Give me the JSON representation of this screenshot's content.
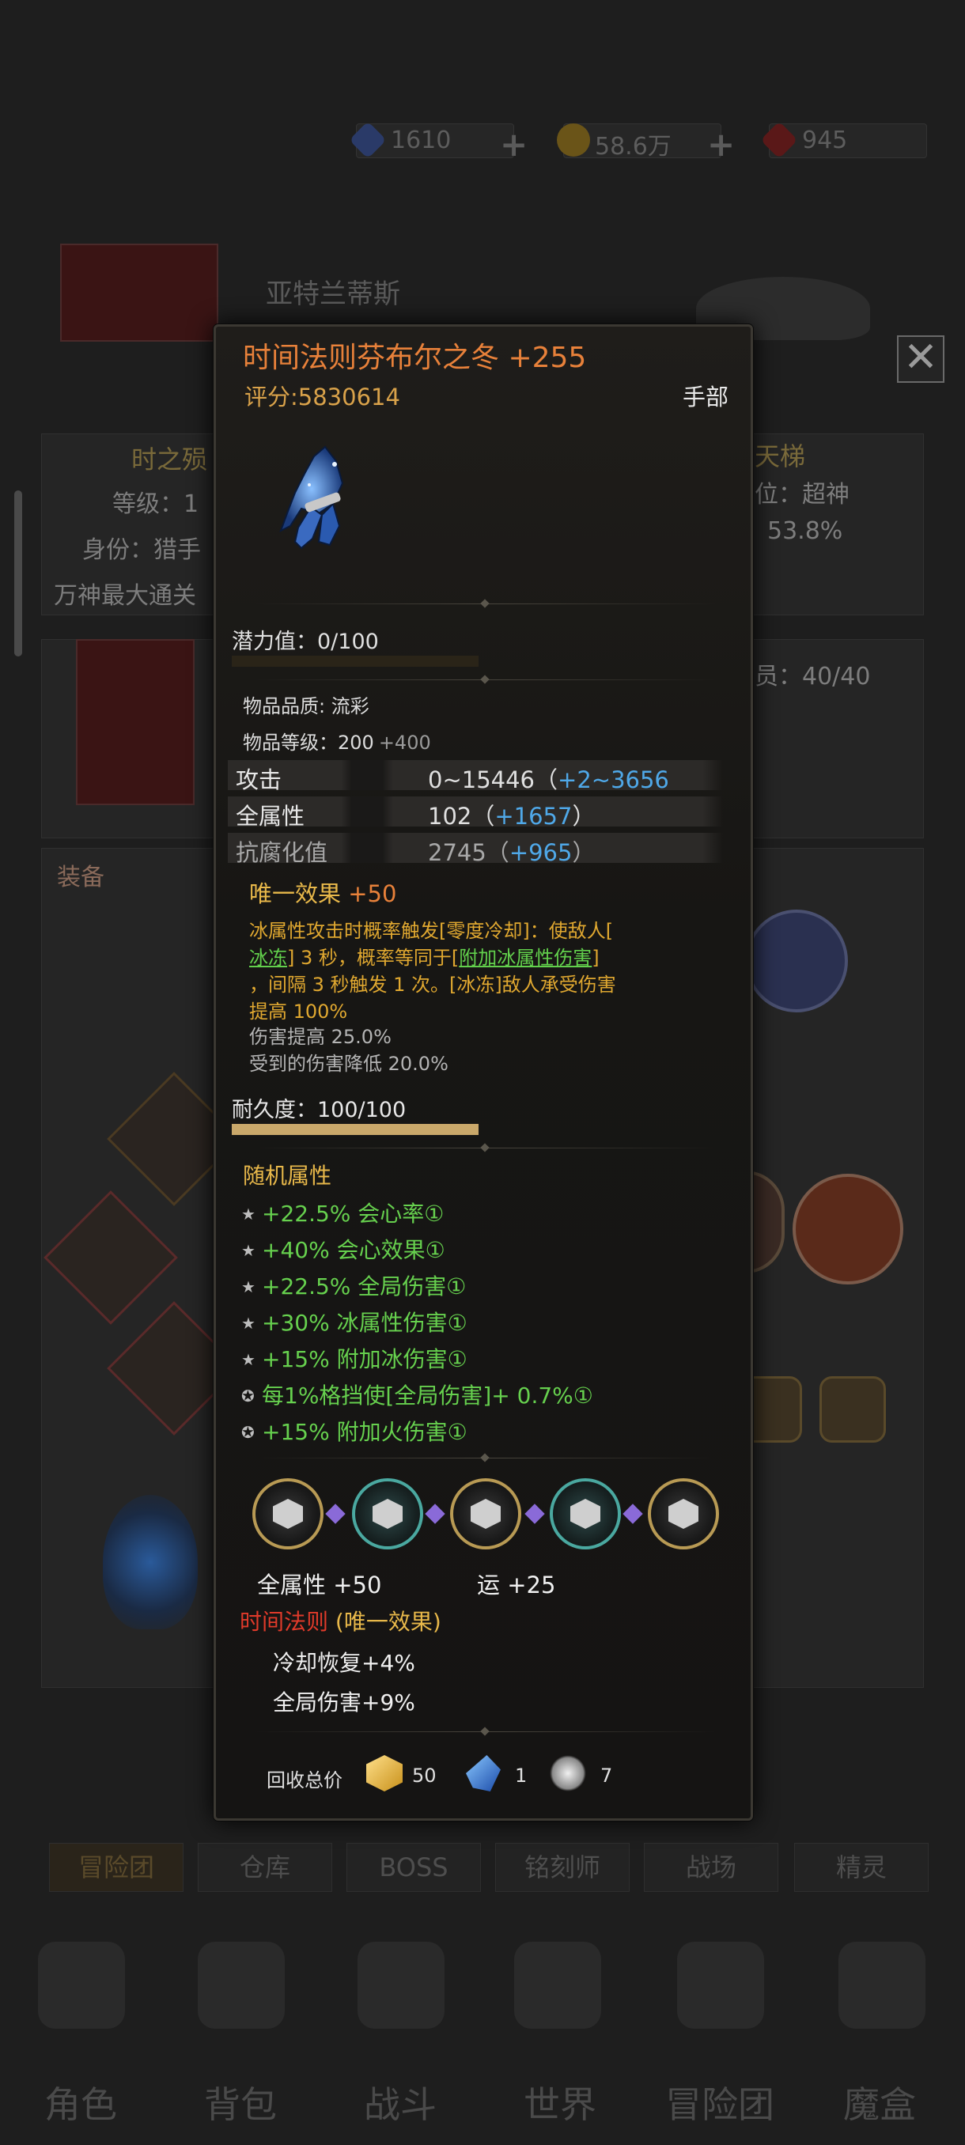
{
  "background": {
    "resources": [
      {
        "icon": "blue-crystal-icon",
        "value": "1610",
        "color": "#3a5aa8"
      },
      {
        "icon": "gold-coin-icon",
        "value": "58.6万",
        "color": "#c8a020"
      },
      {
        "icon": "red-gem-icon",
        "value": "945",
        "color": "#a02828"
      }
    ],
    "player_name": "亚特兰蒂斯",
    "info_left": {
      "title": "时之殒",
      "level": "等级：1",
      "identity": "身份：猎手",
      "pass": "万神最大通关"
    },
    "info_right": {
      "title": "天梯",
      "rank": "位：超神",
      "rate": "：53.8%"
    },
    "guild_members": "成员：40/40",
    "equip_label": "装备",
    "tabs": [
      "冒险团",
      "仓库",
      "BOSS",
      "铭刻师",
      "战场",
      "精灵"
    ],
    "nav": [
      {
        "label": "角色",
        "icon": "helmet-icon"
      },
      {
        "label": "背包",
        "icon": "backpack-icon"
      },
      {
        "label": "战斗",
        "icon": "sword-shield-icon"
      },
      {
        "label": "世界",
        "icon": "scroll-icon"
      },
      {
        "label": "冒险团",
        "icon": "castle-icon"
      },
      {
        "label": "魔盒",
        "icon": "cube-icon"
      }
    ]
  },
  "item": {
    "name": "时间法则芬布尔之冬 +255",
    "score": "评分:5830614",
    "slot": "手部",
    "image_icon": "ice-gauntlet-icon",
    "potential": "潜力值：0/100",
    "potential_fraction": 0.0,
    "quality": "物品品质: 流彩",
    "item_level_label": "物品等级：",
    "item_level": "200",
    "item_level_bonus": "+400",
    "stats": [
      {
        "name": "攻击",
        "base": "0~15446（",
        "bonus": "+2~3656",
        "close": ""
      },
      {
        "name": "全属性",
        "base": "102（",
        "bonus": "+1657",
        "close": "）"
      },
      {
        "name": "抗腐化值",
        "base": "2745（",
        "bonus": "+965",
        "close": "）"
      }
    ],
    "unique": {
      "title": "唯一效果",
      "bonus": "+50",
      "desc_1a": "冰属性攻击时概率触发[零度冷却]：使敌人[",
      "desc_2a": "冰冻",
      "desc_2b": "] 3 秒，概率等同于[",
      "desc_2c": "附加冰属性伤害",
      "desc_2d": "]",
      "desc_3": "，间隔 3 秒触发 1 次。[冰冻]敌人承受伤害",
      "desc_4": "提高 100%",
      "line_5": "伤害提高 25.0%",
      "line_6": "受到的伤害降低 20.0%"
    },
    "durability": "耐久度：100/100",
    "durability_fraction": 1.0,
    "random_title": "随机属性",
    "random_attrs": [
      "+22.5% 会心率①",
      "+40% 会心效果①",
      "+22.5% 全局伤害①",
      "+30% 冰属性伤害①",
      "+15% 附加冰伤害①",
      "每1%格挡使[全局伤害]+ 0.7%①",
      "+15% 附加火伤害①"
    ],
    "gems": [
      {
        "icon": "rune-gem-icon",
        "style": "gold"
      },
      {
        "icon": "rune-gem-icon",
        "style": "teal"
      },
      {
        "icon": "rune-gem-icon",
        "style": "gold"
      },
      {
        "icon": "rune-gem-icon",
        "style": "teal"
      },
      {
        "icon": "rune-gem-icon",
        "style": "gold"
      }
    ],
    "gem_bonus_1": "全属性  +50",
    "gem_bonus_2": "运  +25",
    "set_name": "时间法则",
    "set_tag": "(唯一效果)",
    "set_effects": [
      "冷却恢复+4%",
      "全局伤害+9%"
    ],
    "recycle_label": "回收总价",
    "recycle": [
      {
        "icon": "gold-cube-icon",
        "value": "50"
      },
      {
        "icon": "blue-shard-icon",
        "value": "1"
      },
      {
        "icon": "spiral-essence-icon",
        "value": "7"
      }
    ],
    "colors": {
      "title": "#e8813a",
      "score": "#d9a24a",
      "unique": "#e8b84a",
      "green": "#62d04c",
      "blue": "#4fa8e8",
      "set": "#e03a2a"
    }
  }
}
